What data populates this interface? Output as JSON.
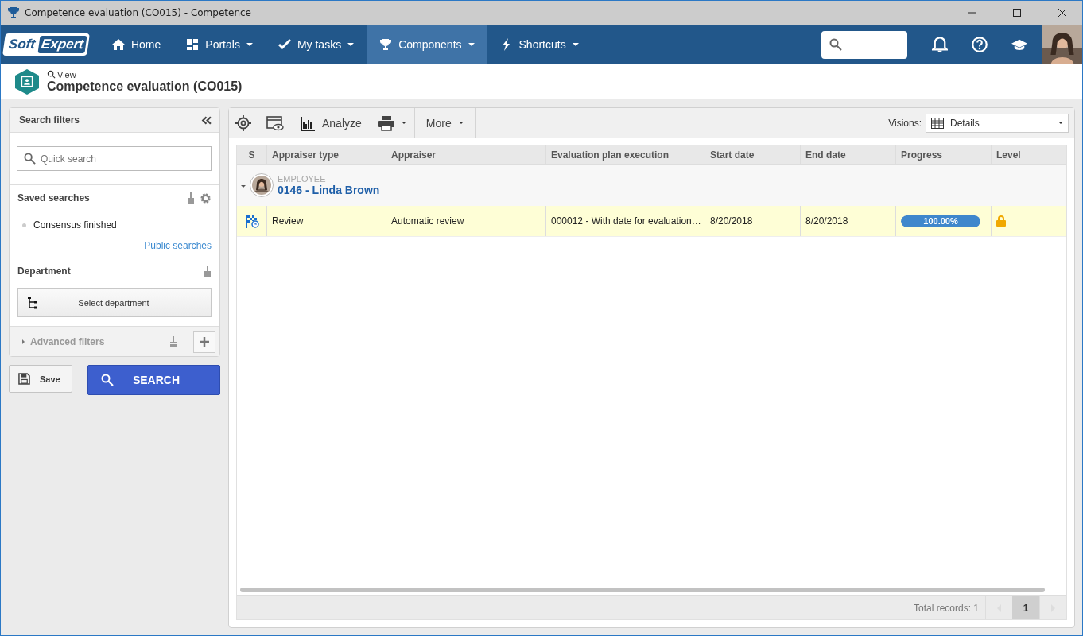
{
  "window": {
    "title": "Competence evaluation (CO015) - Competence"
  },
  "nav": {
    "logo": [
      "Soft",
      "Expert"
    ],
    "items": [
      {
        "label": "Home",
        "kind": "home",
        "dropdown": false,
        "selected": false
      },
      {
        "label": "Portals",
        "kind": "portals",
        "dropdown": true,
        "selected": false
      },
      {
        "label": "My tasks",
        "kind": "check",
        "dropdown": true,
        "selected": false
      },
      {
        "label": "Components",
        "kind": "trophy",
        "dropdown": true,
        "selected": true
      },
      {
        "label": "Shortcuts",
        "kind": "bolt",
        "dropdown": true,
        "selected": false
      }
    ]
  },
  "header": {
    "mode": "View",
    "title": "Competence evaluation (CO015)"
  },
  "filters": {
    "title": "Search filters",
    "quick_search": {
      "placeholder": "Quick search"
    },
    "saved_searches": {
      "title": "Saved searches",
      "items": [
        "Consensus finished"
      ],
      "link": "Public searches"
    },
    "department": {
      "title": "Department",
      "button": "Select department"
    },
    "advanced": {
      "label": "Advanced filters",
      "expanded": false
    },
    "save": "Save",
    "search": "SEARCH"
  },
  "toolbar": {
    "analyze": "Analyze",
    "more": "More",
    "visions_label": "Visions:",
    "vision": "Details"
  },
  "table": {
    "columns": [
      "S",
      "Appraiser type",
      "Appraiser",
      "Evaluation plan execution",
      "Start date",
      "End date",
      "Progress",
      "Level"
    ],
    "group": {
      "type": "EMPLOYEE",
      "name": "0146 - Linda Brown",
      "expanded": true
    },
    "rows": [
      {
        "selected": true,
        "appraiser_type": "Review",
        "appraiser": "Automatic review",
        "plan": "000012 - With date for evaluation…",
        "start": "8/20/2018",
        "end": "8/20/2018",
        "level": 1,
        "reading": "100.00%",
        "locked": true
      }
    ]
  },
  "footer": {
    "total": "Total records: 1",
    "pages": [
      {
        "label": "1",
        "selected": true
      }
    ]
  }
}
